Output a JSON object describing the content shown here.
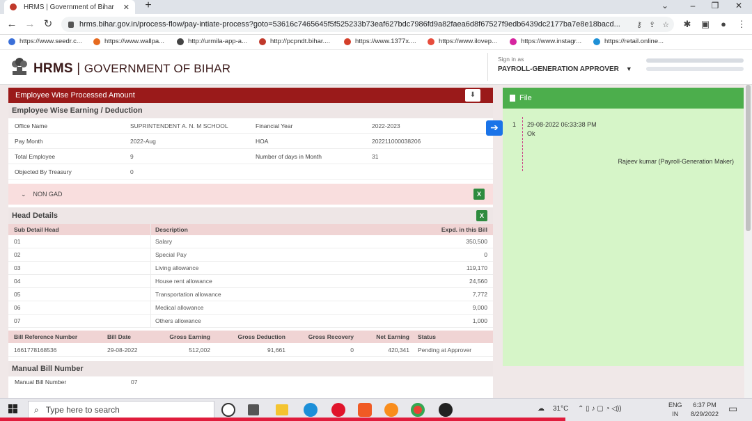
{
  "browser": {
    "tab_title": "HRMS | Government of Bihar",
    "new_tab": "+",
    "url": "hrms.bihar.gov.in/process-flow/pay-intiate-process?goto=53616c7465645f5f525233b73eaf627bdc7986fd9a82faea6d8f67527f9edb6439dc2177ba7e8e18bacd...",
    "bookmarks": [
      {
        "label": "https://www.seedr.c...",
        "color": "#3a6fd8"
      },
      {
        "label": "https://www.wallpa...",
        "color": "#e66a1f"
      },
      {
        "label": "http://urmila-app-a...",
        "color": "#444444"
      },
      {
        "label": "http://pcpndt.bihar....",
        "color": "#c0392b"
      },
      {
        "label": "https://www.1377x....",
        "color": "#d43f2a"
      },
      {
        "label": "https://www.ilovep...",
        "color": "#e74c3c"
      },
      {
        "label": "https://www.instagr...",
        "color": "#d6249f"
      },
      {
        "label": "https://retail.online...",
        "color": "#1e90d6"
      }
    ]
  },
  "header": {
    "brand_bold": "HRMS",
    "brand_sep": "|",
    "brand_rest": "GOVERNMENT OF BIHAR",
    "signin_label": "Sign in as",
    "role": "PAYROLL-GENERATION APPROVER"
  },
  "panel": {
    "title": "Employee Wise Processed Amount",
    "section_title": "Employee Wise Earning / Deduction",
    "info": [
      {
        "l1": "Office Name",
        "v1": "SUPRINTENDENT A. N. M SCHOOL",
        "l2": "Financial Year",
        "v2": "2022-2023"
      },
      {
        "l1": "Pay Month",
        "v1": "2022-Aug",
        "l2": "HOA",
        "v2": "202211000038206"
      },
      {
        "l1": "Total Employee",
        "v1": "9",
        "l2": "Number of days in Month",
        "v2": "31"
      },
      {
        "l1": "Objected By Treasury",
        "v1": "0",
        "l2": "",
        "v2": ""
      }
    ],
    "nongad_label": "NON GAD",
    "head_details_title": "Head Details",
    "head_columns": [
      "Sub Detail Head",
      "Description",
      "Expd. in this Bill"
    ],
    "head_rows": [
      {
        "code": "01",
        "desc": "Salary",
        "amt": "350,500"
      },
      {
        "code": "02",
        "desc": "Special Pay",
        "amt": "0"
      },
      {
        "code": "03",
        "desc": "Living allowance",
        "amt": "119,170"
      },
      {
        "code": "04",
        "desc": "House rent allowance",
        "amt": "24,560"
      },
      {
        "code": "05",
        "desc": "Transportation allowance",
        "amt": "7,772"
      },
      {
        "code": "06",
        "desc": "Medical allowance",
        "amt": "9,000"
      },
      {
        "code": "07",
        "desc": "Others allowance",
        "amt": "1,000"
      }
    ],
    "bill_columns": [
      "Bill Reference Number",
      "Bill Date",
      "Gross Earning",
      "Gross Deduction",
      "Gross Recovery",
      "Net Earning",
      "Status"
    ],
    "bill_row": [
      "1661778168536",
      "29-08-2022",
      "512,002",
      "91,661",
      "0",
      "420,341",
      "Pending at Approver"
    ],
    "manual_bill_title": "Manual Bill Number",
    "manual_bill_label": "Manual Bill Number",
    "manual_bill_value": "07"
  },
  "file_panel": {
    "title": "File",
    "entry_num": "1",
    "entry_date": "29-08-2022 06:33:38 PM",
    "entry_msg": "Ok",
    "entry_by": "Rajeev kumar (Payroll-Generation Maker)"
  },
  "taskbar": {
    "search_placeholder": "Type here to search",
    "temperature": "31°C",
    "lang1": "ENG",
    "lang2": "IN",
    "time": "6:37 PM",
    "date": "8/29/2022"
  }
}
